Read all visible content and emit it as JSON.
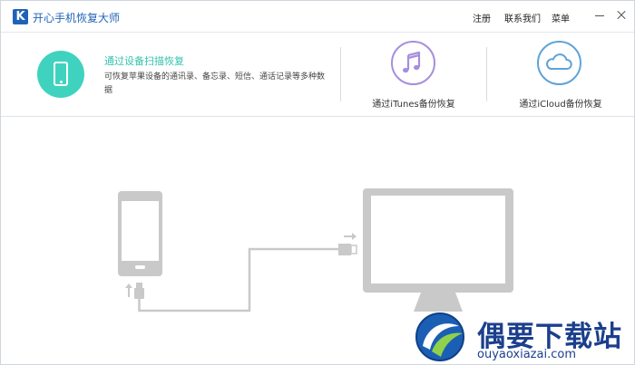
{
  "app": {
    "logo_letter": "K",
    "title": "开心手机恢复大师",
    "brand_color": "#1f63b8"
  },
  "titlebar": {
    "menu": [
      {
        "label": "注册",
        "icon": ""
      },
      {
        "label": "联系我们",
        "icon": ""
      },
      {
        "label": "菜单",
        "icon": ""
      }
    ],
    "window_buttons": [
      "minimize-icon",
      "close-icon"
    ]
  },
  "modes": {
    "device": {
      "title": "通过设备扫描恢复",
      "description": "可恢复苹果设备的通讯录、备忘录、短信、通话记录等多种数据",
      "icon": "phone-icon",
      "accent": "#3fd3bf"
    },
    "itunes": {
      "label": "通过iTunes备份恢复",
      "icon": "music-note-icon",
      "accent": "#a58fdc"
    },
    "icloud": {
      "label": "通过iCloud备份恢复",
      "icon": "cloud-icon",
      "accent": "#5ea3d8"
    }
  },
  "illustration": {
    "description_icons": [
      "phone-outline-icon",
      "usb-cable-icon",
      "monitor-outline-icon"
    ],
    "color": "#c9c9c9"
  },
  "watermark": {
    "name": "偶要下载站",
    "url": "ouyaoxiazai.com"
  }
}
